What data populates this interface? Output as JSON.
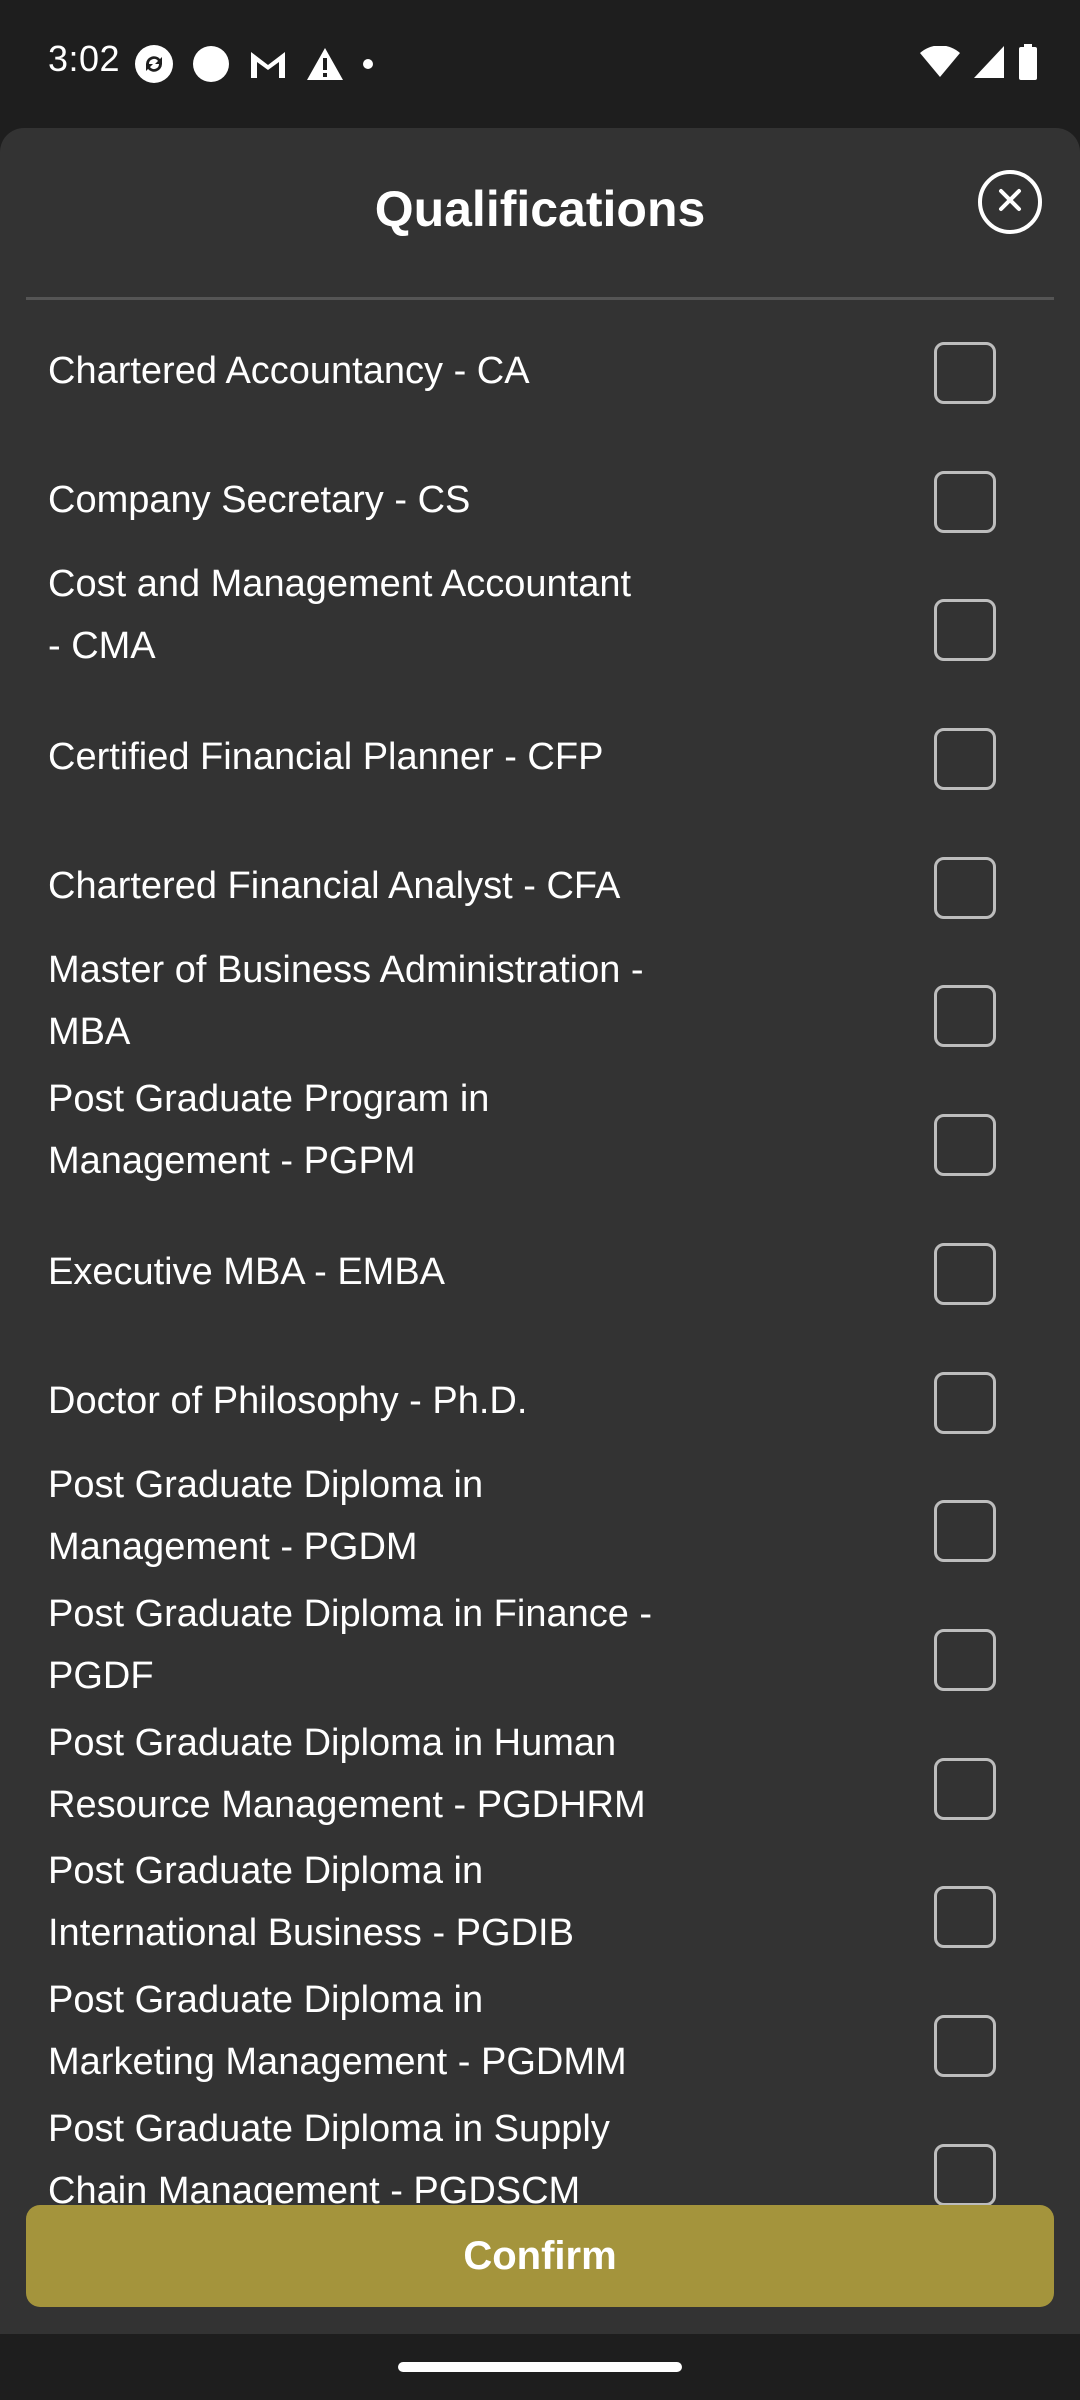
{
  "status_bar": {
    "time": "3:02",
    "left_icons": [
      "sync-icon",
      "circle-icon",
      "gmail-icon",
      "warning-icon",
      "dot-icon"
    ],
    "right_icons": [
      "wifi-icon",
      "signal-icon",
      "battery-icon"
    ]
  },
  "sheet": {
    "title": "Qualifications",
    "close_icon": "close-circle-icon",
    "items": [
      {
        "label": "Chartered Accountancy  - CA",
        "checked": false
      },
      {
        "label": "Company Secretary - CS",
        "checked": false
      },
      {
        "label": "Cost and Management Accountant\n- CMA",
        "checked": false
      },
      {
        "label": "Certified Financial Planner - CFP",
        "checked": false
      },
      {
        "label": "Chartered Financial Analyst - CFA",
        "checked": false
      },
      {
        "label": "Master of Business Administration -\nMBA",
        "checked": false
      },
      {
        "label": "Post Graduate Program in\nManagement - PGPM",
        "checked": false
      },
      {
        "label": "Executive MBA - EMBA",
        "checked": false
      },
      {
        "label": "Doctor of Philosophy - Ph.D.",
        "checked": false
      },
      {
        "label": "Post Graduate Diploma in\nManagement - PGDM",
        "checked": false
      },
      {
        "label": "Post Graduate Diploma in Finance -\nPGDF",
        "checked": false
      },
      {
        "label": "Post Graduate Diploma in Human\nResource Management - PGDHRM",
        "checked": false
      },
      {
        "label": "Post Graduate Diploma in\nInternational Business - PGDIB",
        "checked": false
      },
      {
        "label": "Post Graduate Diploma in\nMarketing Management - PGDMM",
        "checked": false
      },
      {
        "label": "Post Graduate Diploma in Supply\nChain Management - PGDSCM",
        "checked": false
      }
    ],
    "confirm_label": "Confirm"
  },
  "colors": {
    "sheet_bg": "#333333",
    "status_bg": "#1e1e1e",
    "accent": "#a4943c",
    "checkbox_border": "#bdbdbd"
  }
}
